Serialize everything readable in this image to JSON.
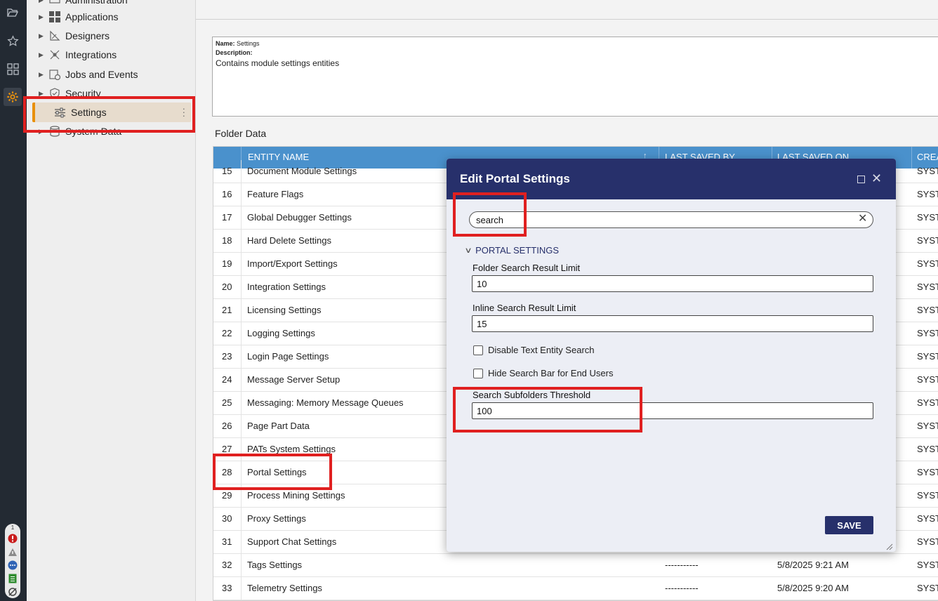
{
  "rail": {
    "icons": [
      "folder-open-icon",
      "star-icon",
      "dashboard-grid-icon",
      "gear-icon"
    ],
    "status": {
      "count": "1"
    }
  },
  "tree": {
    "items": [
      {
        "label": "Administration",
        "icon": "administration-icon"
      },
      {
        "label": "Applications",
        "icon": "applications-icon"
      },
      {
        "label": "Designers",
        "icon": "designers-icon"
      },
      {
        "label": "Integrations",
        "icon": "integrations-icon"
      },
      {
        "label": "Jobs and Events",
        "icon": "jobs-events-icon"
      },
      {
        "label": "Security",
        "icon": "security-icon"
      },
      {
        "label": "Settings",
        "icon": "settings-sliders-icon"
      },
      {
        "label": "System Data",
        "icon": "system-data-icon"
      }
    ]
  },
  "info": {
    "name_label": "Name:",
    "name_value": "Settings",
    "description_label": "Description:",
    "description_value": "Contains module settings entities"
  },
  "folder": {
    "title": "Folder Data",
    "columns": [
      "ENTITY NAME",
      "LAST SAVED BY",
      "LAST SAVED ON",
      "CREA"
    ],
    "rows": [
      {
        "id": "15",
        "name": "Document Module Settings",
        "by": "",
        "on": "",
        "created": "SYST"
      },
      {
        "id": "16",
        "name": "Feature Flags",
        "by": "",
        "on": "",
        "created": "SYST"
      },
      {
        "id": "17",
        "name": "Global Debugger Settings",
        "by": "",
        "on": "",
        "created": "SYST"
      },
      {
        "id": "18",
        "name": "Hard Delete Settings",
        "by": "",
        "on": "",
        "created": "SYST"
      },
      {
        "id": "19",
        "name": "Import/Export Settings",
        "by": "",
        "on": "",
        "created": "SYST"
      },
      {
        "id": "20",
        "name": "Integration Settings",
        "by": "",
        "on": "",
        "created": "SYST"
      },
      {
        "id": "21",
        "name": "Licensing Settings",
        "by": "",
        "on": "",
        "created": "SYST"
      },
      {
        "id": "22",
        "name": "Logging Settings",
        "by": "",
        "on": "",
        "created": "SYST"
      },
      {
        "id": "23",
        "name": "Login Page Settings",
        "by": "",
        "on": "",
        "created": "SYST"
      },
      {
        "id": "24",
        "name": "Message Server Setup",
        "by": "",
        "on": "",
        "created": "SYST"
      },
      {
        "id": "25",
        "name": "Messaging: Memory Message Queues",
        "by": "",
        "on": "",
        "created": "SYST"
      },
      {
        "id": "26",
        "name": "Page Part Data",
        "by": "",
        "on": "",
        "created": "SYST"
      },
      {
        "id": "27",
        "name": "PATs System Settings",
        "by": "",
        "on": "",
        "created": "SYST"
      },
      {
        "id": "28",
        "name": "Portal Settings",
        "by": "",
        "on": "",
        "created": "SYST"
      },
      {
        "id": "29",
        "name": "Process Mining Settings",
        "by": "",
        "on": "",
        "created": "SYST"
      },
      {
        "id": "30",
        "name": "Proxy Settings",
        "by": "",
        "on": "",
        "created": "SYST"
      },
      {
        "id": "31",
        "name": "Support Chat Settings",
        "by": "",
        "on": "",
        "created": "SYST"
      },
      {
        "id": "32",
        "name": "Tags Settings",
        "by": "-----------",
        "on": "5/8/2025 9:21 AM",
        "created": "SYST"
      },
      {
        "id": "33",
        "name": "Telemetry Settings",
        "by": "-----------",
        "on": "5/8/2025 9:20 AM",
        "created": "SYST"
      }
    ]
  },
  "modal": {
    "title": "Edit Portal Settings",
    "search_value": "search",
    "section": "PORTAL SETTINGS",
    "fields": [
      {
        "label": "Folder Search Result Limit",
        "value": "10"
      },
      {
        "label": "Inline Search Result Limit",
        "value": "15"
      }
    ],
    "checkboxes": [
      {
        "label": "Disable Text Entity Search",
        "checked": false
      },
      {
        "label": "Hide Search Bar for End Users",
        "checked": false
      }
    ],
    "threshold": {
      "label": "Search Subfolders Threshold",
      "value": "100"
    },
    "save_label": "SAVE"
  },
  "colors": {
    "modal_header": "#27306b",
    "grid_header": "#4a91cc",
    "accent": "#e8900c",
    "highlight": "#e02020"
  }
}
